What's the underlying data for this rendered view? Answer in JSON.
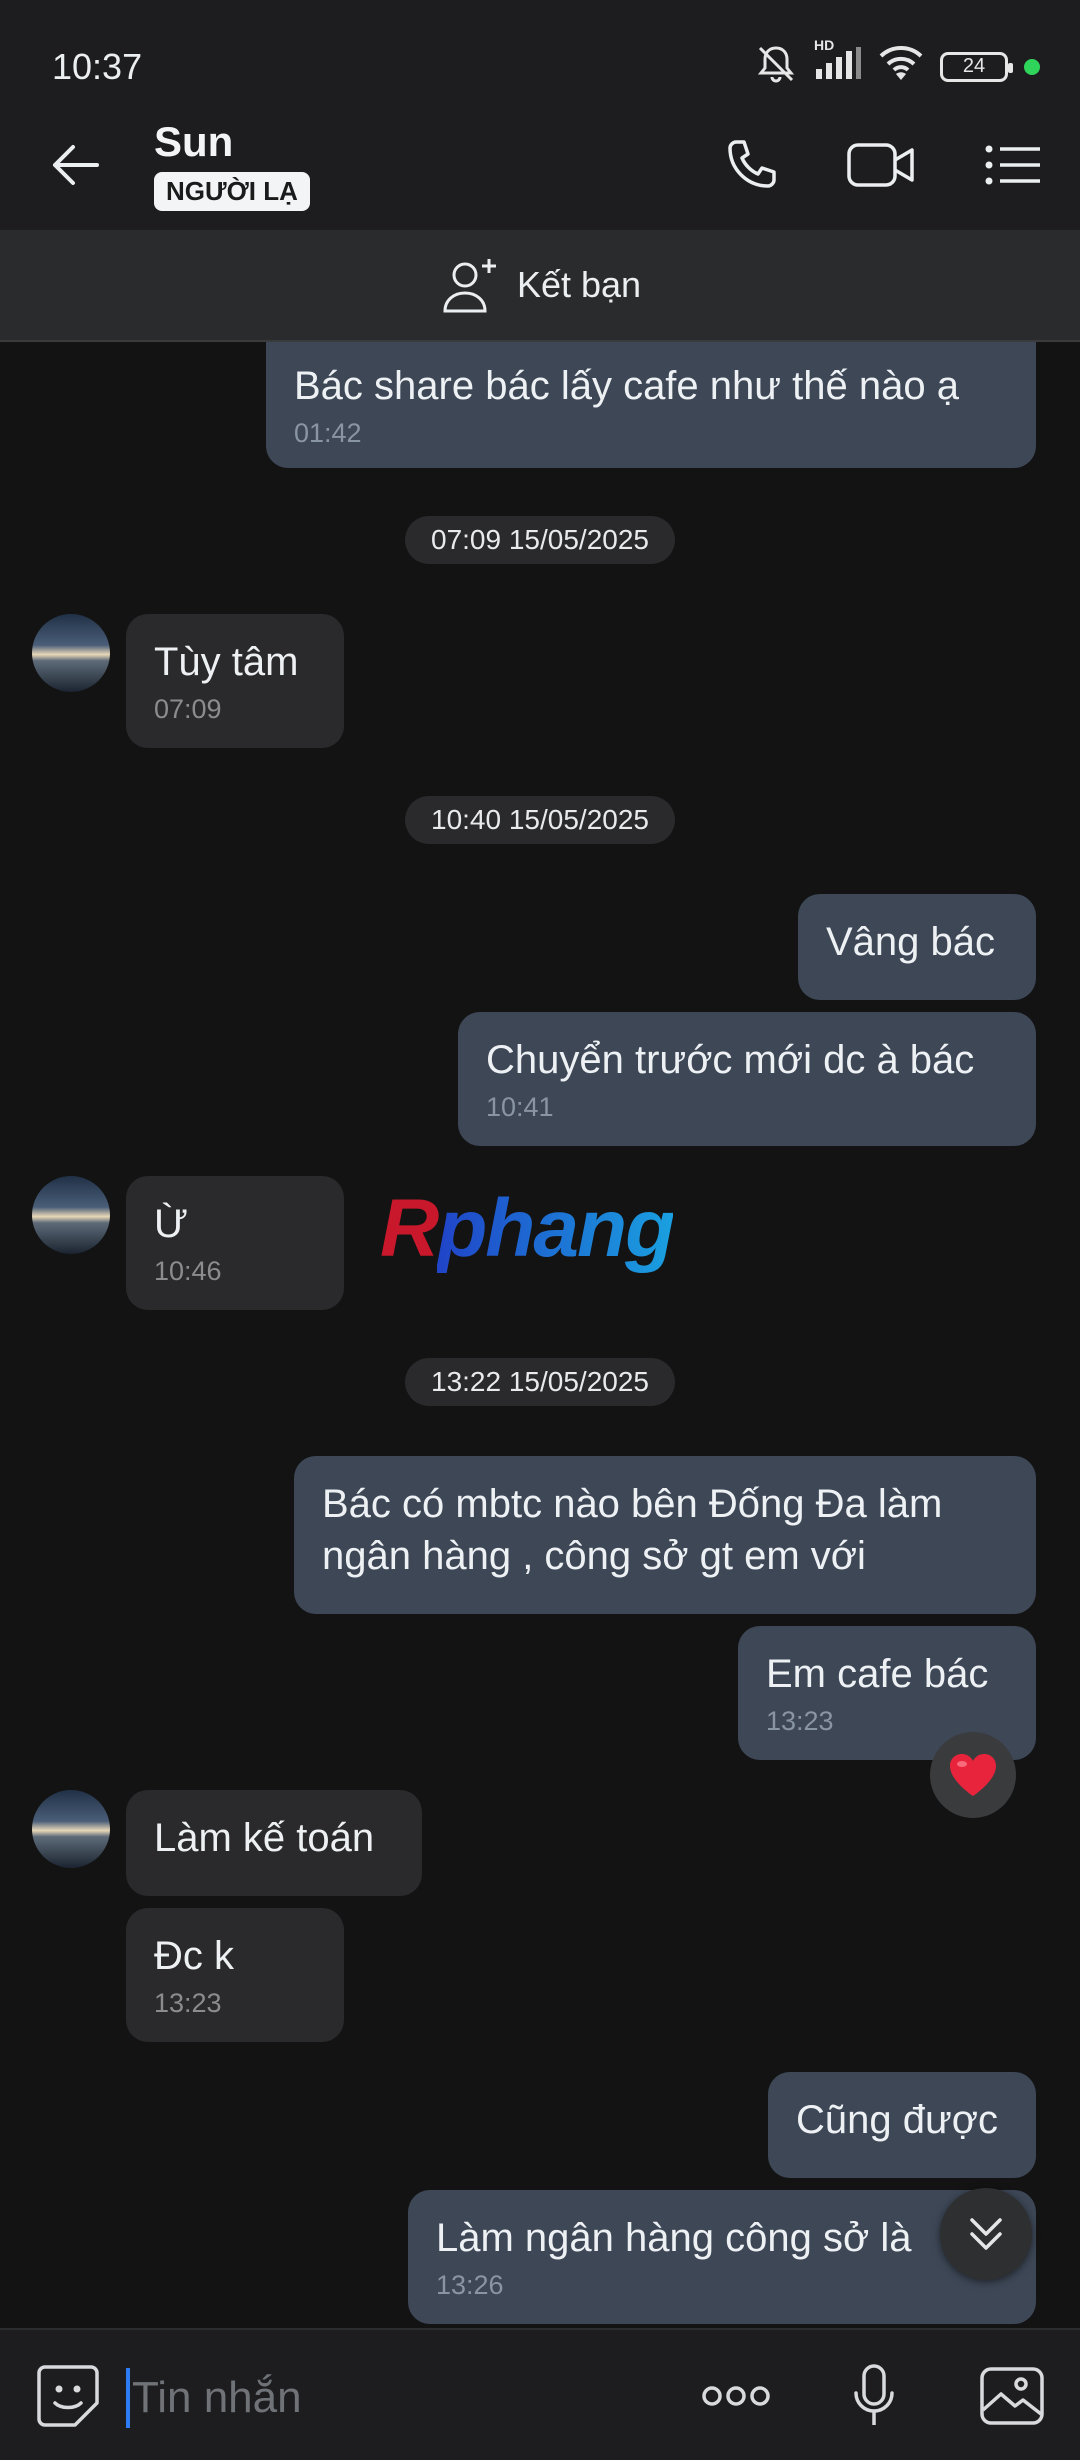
{
  "status_bar": {
    "time": "10:37",
    "battery": "24",
    "network_label": "HD"
  },
  "header": {
    "contact_name": "Sun",
    "badge": "NGƯỜI LẠ"
  },
  "add_friend": {
    "label": "Kết bạn"
  },
  "dates": [
    "07:09 15/05/2025",
    "10:40 15/05/2025",
    "13:22 15/05/2025"
  ],
  "messages": [
    {
      "dir": "out",
      "text": "Bác share bác lấy cafe như thế nào ạ",
      "time": "01:42"
    },
    {
      "dir": "in",
      "text": "Tùy tâm",
      "time": "07:09"
    },
    {
      "dir": "out",
      "text": "Vâng bác",
      "time": ""
    },
    {
      "dir": "out",
      "text": "Chuyển trước mới dc à bác",
      "time": "10:41"
    },
    {
      "dir": "in",
      "text": "Ừ",
      "time": "10:46"
    },
    {
      "dir": "out",
      "text": "Bác có mbtc nào bên Đống Đa làm",
      "text2": "ngân hàng , công sở gt em với",
      "time": ""
    },
    {
      "dir": "out",
      "text": "Em cafe bác",
      "time": "13:23"
    },
    {
      "dir": "in",
      "text": "Làm kế toán",
      "time": ""
    },
    {
      "dir": "in",
      "text": "Đc k",
      "time": "13:23"
    },
    {
      "dir": "out",
      "text": "Cũng được",
      "time": ""
    },
    {
      "dir": "out",
      "text": "Làm ngân hàng công sở là",
      "time": "13:26"
    }
  ],
  "watermark": {
    "first": "R",
    "rest": "phang"
  },
  "composer": {
    "placeholder": "Tin nhắn"
  },
  "colors": {
    "bubble_out": "#3d4756",
    "bubble_in": "#2a2a2c",
    "background": "#131314",
    "accent": "#2d7cf6",
    "heart": "#e8243c"
  }
}
